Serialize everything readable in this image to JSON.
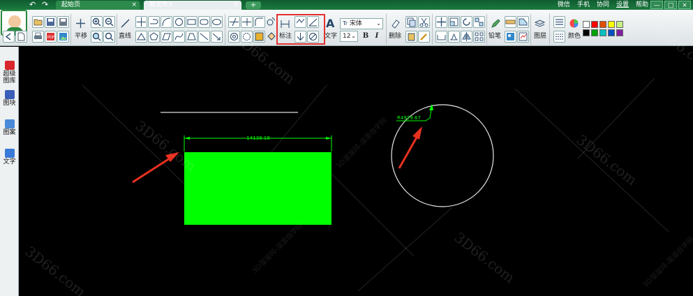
{
  "titlebar": {
    "tabs": [
      {
        "label": "起始页",
        "close": "×"
      },
      {
        "label": "新文件3",
        "close": "×"
      }
    ],
    "add_tab": "+",
    "links": [
      "微信",
      "手机",
      "协同",
      "设置",
      "帮助"
    ],
    "window_buttons": [
      "—",
      "□",
      "×"
    ]
  },
  "toolbar": {
    "labels": {
      "pan": "平移",
      "line": "直线",
      "dimension": "标注",
      "text": "文字",
      "erase": "删除",
      "pen": "铅笔",
      "layers": "图层",
      "color": "颜色"
    },
    "font": {
      "name": "宋体",
      "size": "12",
      "font_icon": "Tr"
    },
    "format_buttons": [
      "B",
      "I"
    ],
    "colors": [
      "#ffffff",
      "#ff0000",
      "#e05000",
      "#ffff00",
      "#c8f080",
      "#000000",
      "#00a000",
      "#00c0c0",
      "#0050c0",
      "#8020a0"
    ]
  },
  "sidebar": {
    "items": [
      {
        "label": "超级图库",
        "icon": "gallery-icon"
      },
      {
        "label": "图块",
        "icon": "block-icon"
      },
      {
        "label": "图案",
        "icon": "pattern-icon"
      },
      {
        "label": "文字",
        "icon": "text-icon"
      }
    ]
  },
  "drawing": {
    "dimension_text": "14138.18",
    "radius_text": "R4929.67",
    "fill_color": "#00ff00",
    "arrow_color": "#e83020"
  },
  "watermarks": {
    "site": "3D66.com",
    "site_cn": "3D溜溜网-溜溜自学网"
  }
}
